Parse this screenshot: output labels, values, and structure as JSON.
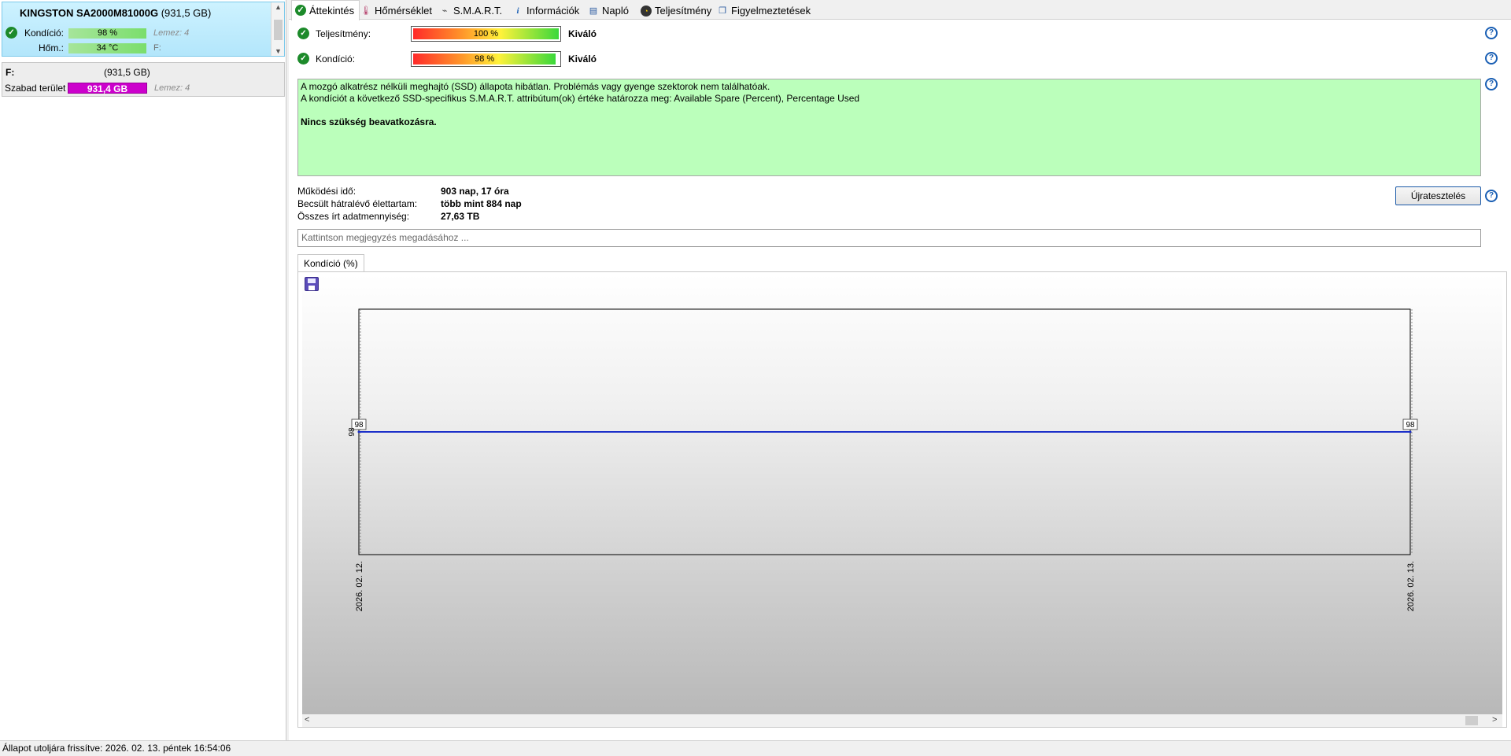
{
  "disk": {
    "name": "KINGSTON SA2000M81000G",
    "size": "(931,5 GB)",
    "health_label": "Kondíció:",
    "health_value": "98 %",
    "health_disk": "Lemez: 4",
    "temp_label": "Hőm.:",
    "temp_value": "34 °C",
    "temp_drive": "F:"
  },
  "volume": {
    "letter": "F:",
    "size": "(931,5 GB)",
    "free_label": "Szabad terület",
    "free_value": "931,4 GB",
    "disk": "Lemez: 4"
  },
  "tabs": [
    {
      "label": "Áttekintés",
      "icon": "check-circle-icon"
    },
    {
      "label": "Hőmérséklet",
      "icon": "thermometer-icon"
    },
    {
      "label": "S.M.A.R.T.",
      "icon": "smart-icon"
    },
    {
      "label": "Információk",
      "icon": "info-icon"
    },
    {
      "label": "Napló",
      "icon": "log-icon"
    },
    {
      "label": "Teljesítmény",
      "icon": "gauge-icon"
    },
    {
      "label": "Figyelmeztetések",
      "icon": "alerts-icon"
    }
  ],
  "overview": {
    "performance_label": "Teljesítmény:",
    "performance_value": "100 %",
    "performance_percent": 100,
    "performance_word": "Kiváló",
    "health_label": "Kondíció:",
    "health_value": "98 %",
    "health_percent": 98,
    "health_word": "Kiváló",
    "status_line1": "A mozgó alkatrész nélküli meghajtó (SSD) állapota hibátlan. Problémás vagy gyenge szektorok nem találhatóak.",
    "status_line2": "A kondíciót a következő SSD-specifikus S.M.A.R.T. attribútum(ok) értéke határozza meg:  Available Spare (Percent), Percentage Used",
    "status_line3": "Nincs szükség beavatkozásra.",
    "power_on_label": "Működési idő:",
    "power_on_value": "903 nap, 17 óra",
    "remaining_label": "Becsült hátralévő élettartam:",
    "remaining_value": "több mint 884 nap",
    "written_label": "Összes írt adatmennyiség:",
    "written_value": "27,63 TB",
    "retest_button": "Újratesztelés",
    "note_placeholder": "Kattintson megjegyzés megadásához ..."
  },
  "chart_tab": "Kondíció  (%)",
  "chart_data": {
    "type": "line",
    "x": [
      "2026. 02. 12.",
      "2026. 02. 13."
    ],
    "series": [
      {
        "values": [
          98,
          98
        ],
        "color": "#1b2fc9"
      }
    ],
    "point_labels": [
      "98",
      "98"
    ],
    "y_tick_labels": [
      "98"
    ],
    "grid": false
  },
  "statusbar": "Állapot utoljára frissítve: 2026. 02. 13. péntek 16:54:06"
}
